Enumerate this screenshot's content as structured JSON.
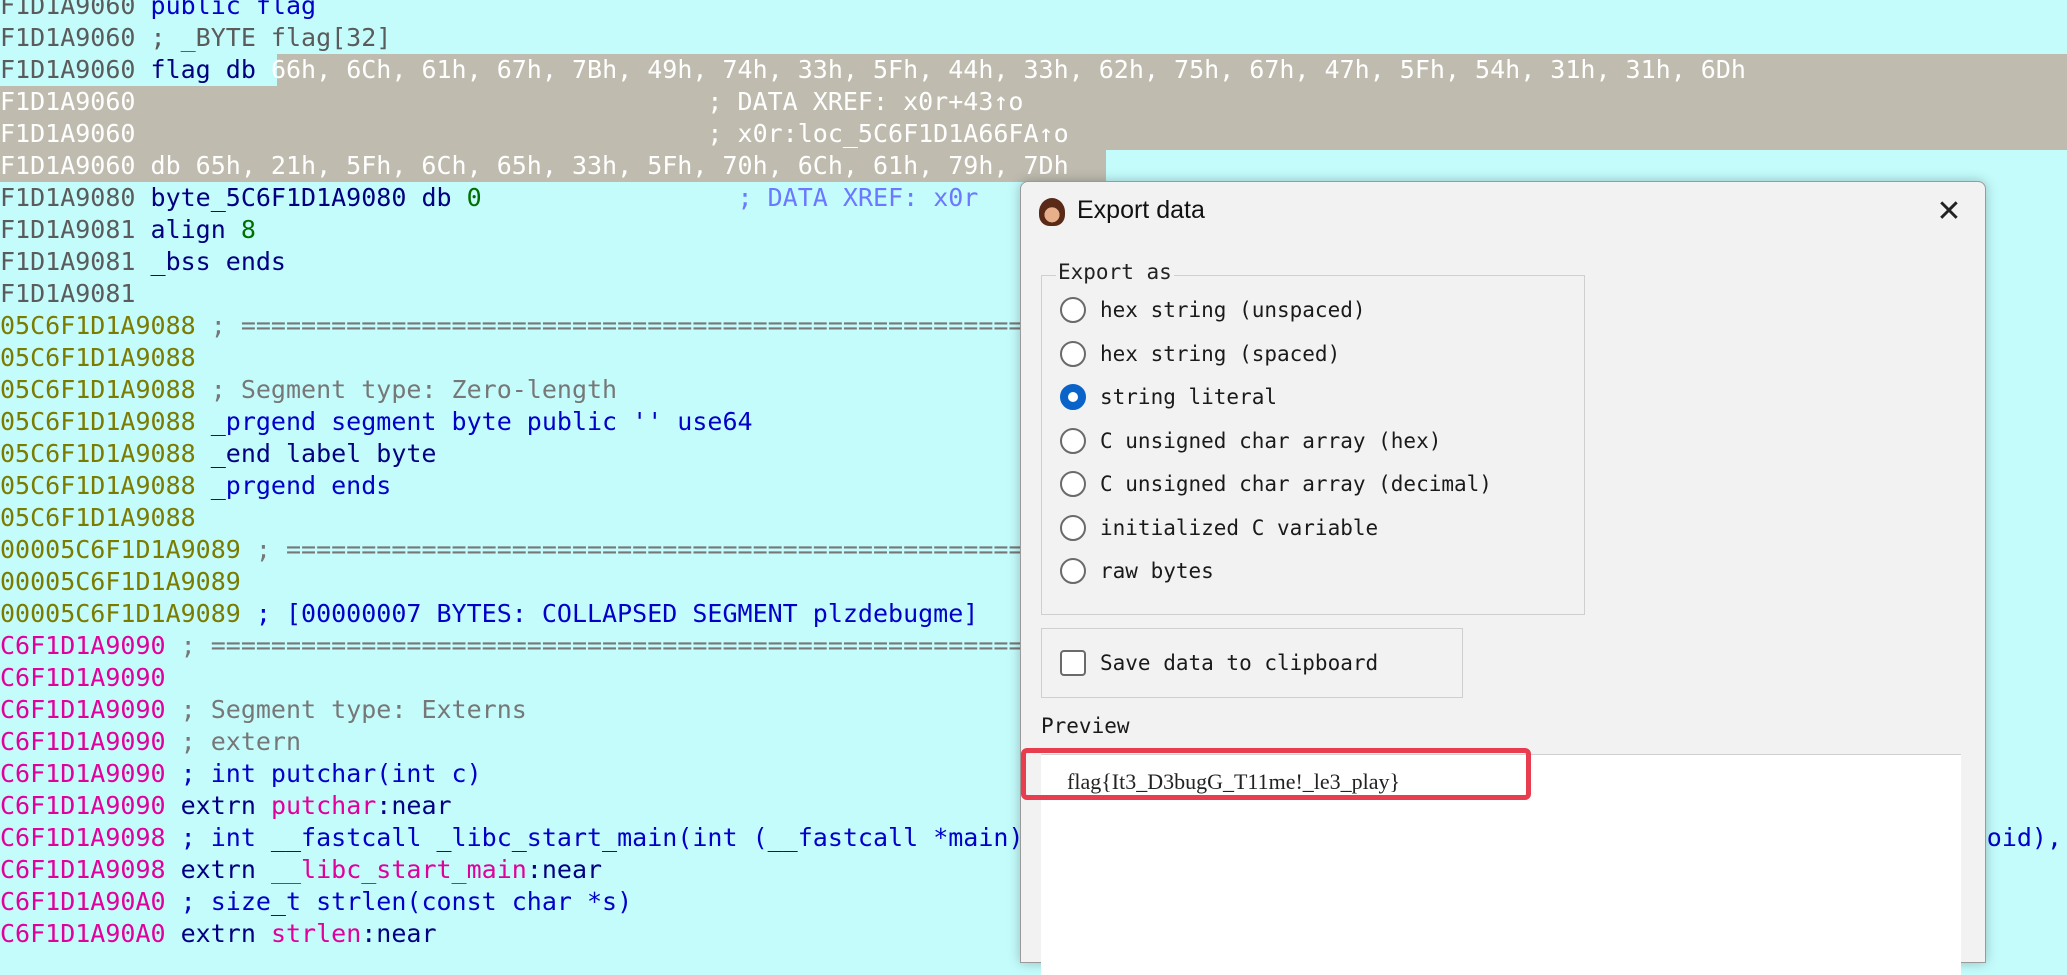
{
  "code_lines": [
    [
      {
        "t": "F1D1A9060 ",
        "c": "c-gray"
      },
      {
        "t": "public flag",
        "c": "c-blue"
      }
    ],
    [
      {
        "t": "F1D1A9060 ",
        "c": "c-gray"
      },
      {
        "t": "; _BYTE flag[32]",
        "c": "c-gray"
      }
    ],
    [
      {
        "t": "F1D1A9060 ",
        "c": "c-gray"
      },
      {
        "t": "flag db ",
        "c": "c-navy"
      },
      {
        "t": "66h, 6Ch, 61h, 67h, 7Bh, 49h, 74h, 33h, 5Fh, 44h, 33h, 62h, 75h, 67h, 47h, 5Fh, 54h, 31h, 31h, 6Dh",
        "c": "c-white"
      }
    ],
    [
      {
        "t": "F1D1A9060                                      ; DATA XREF: x0r+43↑o",
        "c": "c-white"
      }
    ],
    [
      {
        "t": "F1D1A9060                                      ; x0r:loc_5C6F1D1A66FA↑o",
        "c": "c-white"
      }
    ],
    [
      {
        "t": "F1D1A9060 db 65h, 21h, 5Fh, 6Ch, 65h, 33h, 5Fh, 70h, 6Ch, 61h, 79h, 7Dh",
        "c": "c-white"
      }
    ],
    [
      {
        "t": "F1D1A9080 ",
        "c": "c-gray"
      },
      {
        "t": "byte_5C6F1D1A9080 db ",
        "c": "c-navy"
      },
      {
        "t": "0",
        "c": "c-green"
      },
      {
        "t": "                 ; DATA XREF: x0r",
        "c": "c-xref"
      }
    ],
    [
      {
        "t": "F1D1A9081 ",
        "c": "c-gray"
      },
      {
        "t": "align ",
        "c": "c-navy"
      },
      {
        "t": "8",
        "c": "c-green"
      }
    ],
    [
      {
        "t": "F1D1A9081 ",
        "c": "c-gray"
      },
      {
        "t": "_bss ends",
        "c": "c-navy"
      }
    ],
    [
      {
        "t": "F1D1A9081",
        "c": "c-gray"
      }
    ],
    [
      {
        "t": "05C6F1D1A9088 ",
        "c": "c-olive"
      },
      {
        "t": "; =========================================================================",
        "c": "c-cmt"
      }
    ],
    [
      {
        "t": "05C6F1D1A9088",
        "c": "c-olive"
      }
    ],
    [
      {
        "t": "05C6F1D1A9088 ",
        "c": "c-olive"
      },
      {
        "t": "; Segment type: Zero-length",
        "c": "c-cmt"
      }
    ],
    [
      {
        "t": "05C6F1D1A9088 ",
        "c": "c-olive"
      },
      {
        "t": "_prgend segment byte public '' use64",
        "c": "c-blue"
      }
    ],
    [
      {
        "t": "05C6F1D1A9088 ",
        "c": "c-olive"
      },
      {
        "t": "_end label byte",
        "c": "c-navy"
      }
    ],
    [
      {
        "t": "05C6F1D1A9088 ",
        "c": "c-olive"
      },
      {
        "t": "_prgend ends",
        "c": "c-blue"
      }
    ],
    [
      {
        "t": "05C6F1D1A9088",
        "c": "c-olive"
      }
    ],
    [
      {
        "t": "00005C6F1D1A9089 ",
        "c": "c-olive"
      },
      {
        "t": "; =====================================================================",
        "c": "c-cmt"
      }
    ],
    [
      {
        "t": "00005C6F1D1A9089",
        "c": "c-olive"
      }
    ],
    [
      {
        "t": "00005C6F1D1A9089 ",
        "c": "c-olive"
      },
      {
        "t": "; [00000007 BYTES: COLLAPSED SEGMENT plzdebugme]",
        "c": "c-blue"
      }
    ],
    [
      {
        "t": "C6F1D1A9090 ",
        "c": "c-mag"
      },
      {
        "t": "; =========================================================================",
        "c": "c-cmt"
      }
    ],
    [
      {
        "t": "C6F1D1A9090",
        "c": "c-mag"
      }
    ],
    [
      {
        "t": "C6F1D1A9090 ",
        "c": "c-mag"
      },
      {
        "t": "; Segment type: Externs",
        "c": "c-cmt"
      }
    ],
    [
      {
        "t": "C6F1D1A9090 ",
        "c": "c-mag"
      },
      {
        "t": "; extern",
        "c": "c-cmt"
      }
    ],
    [
      {
        "t": "C6F1D1A9090 ",
        "c": "c-mag"
      },
      {
        "t": "; int putchar(int c)",
        "c": "c-blue"
      }
    ],
    [
      {
        "t": "C6F1D1A9090 ",
        "c": "c-mag"
      },
      {
        "t": "extrn ",
        "c": "c-navy"
      },
      {
        "t": "putchar",
        "c": "c-mag"
      },
      {
        "t": ":near",
        "c": "c-navy"
      }
    ],
    [
      {
        "t": "C6F1D1A9098 ",
        "c": "c-mag"
      },
      {
        "t": "; int __fastcall _libc_start_main(int (__fastcall *main)(int, char **, char **), int argc, char **ubp_av, void (*init)(void), void (*fini)(void), void (*rtld_fini)(void",
        "c": "c-blue"
      }
    ],
    [
      {
        "t": "C6F1D1A9098 ",
        "c": "c-mag"
      },
      {
        "t": "extrn ",
        "c": "c-navy"
      },
      {
        "t": "__libc_start_main",
        "c": "c-mag"
      },
      {
        "t": ":near",
        "c": "c-navy"
      }
    ],
    [
      {
        "t": "C6F1D1A90A0 ",
        "c": "c-mag"
      },
      {
        "t": "; size_t strlen(const char *s)",
        "c": "c-blue"
      }
    ],
    [
      {
        "t": "C6F1D1A90A0 ",
        "c": "c-mag"
      },
      {
        "t": "extrn ",
        "c": "c-navy"
      },
      {
        "t": "strlen",
        "c": "c-mag"
      },
      {
        "t": ":near",
        "c": "c-navy"
      }
    ]
  ],
  "dialog": {
    "title": "Export data",
    "close_glyph": "✕",
    "export_as_legend": "Export as",
    "options": [
      {
        "label": "hex string (unspaced)",
        "selected": false
      },
      {
        "label": "hex string (spaced)",
        "selected": false
      },
      {
        "label": "string literal",
        "selected": true
      },
      {
        "label": "C unsigned char array (hex)",
        "selected": false
      },
      {
        "label": "C unsigned char array (decimal)",
        "selected": false
      },
      {
        "label": "initialized C variable",
        "selected": false
      },
      {
        "label": "raw bytes",
        "selected": false
      }
    ],
    "save_clipboard_label": "Save data to clipboard",
    "save_clipboard_checked": false,
    "preview_label": "Preview",
    "preview_text": "flag{It3_D3bugG_T11me!_le3_play}"
  },
  "colors": {
    "background": "#c4fcfc",
    "selection": "#bfbcaf",
    "radio_selected": "#0a63c8",
    "preview_highlight": "#e83c4f"
  }
}
